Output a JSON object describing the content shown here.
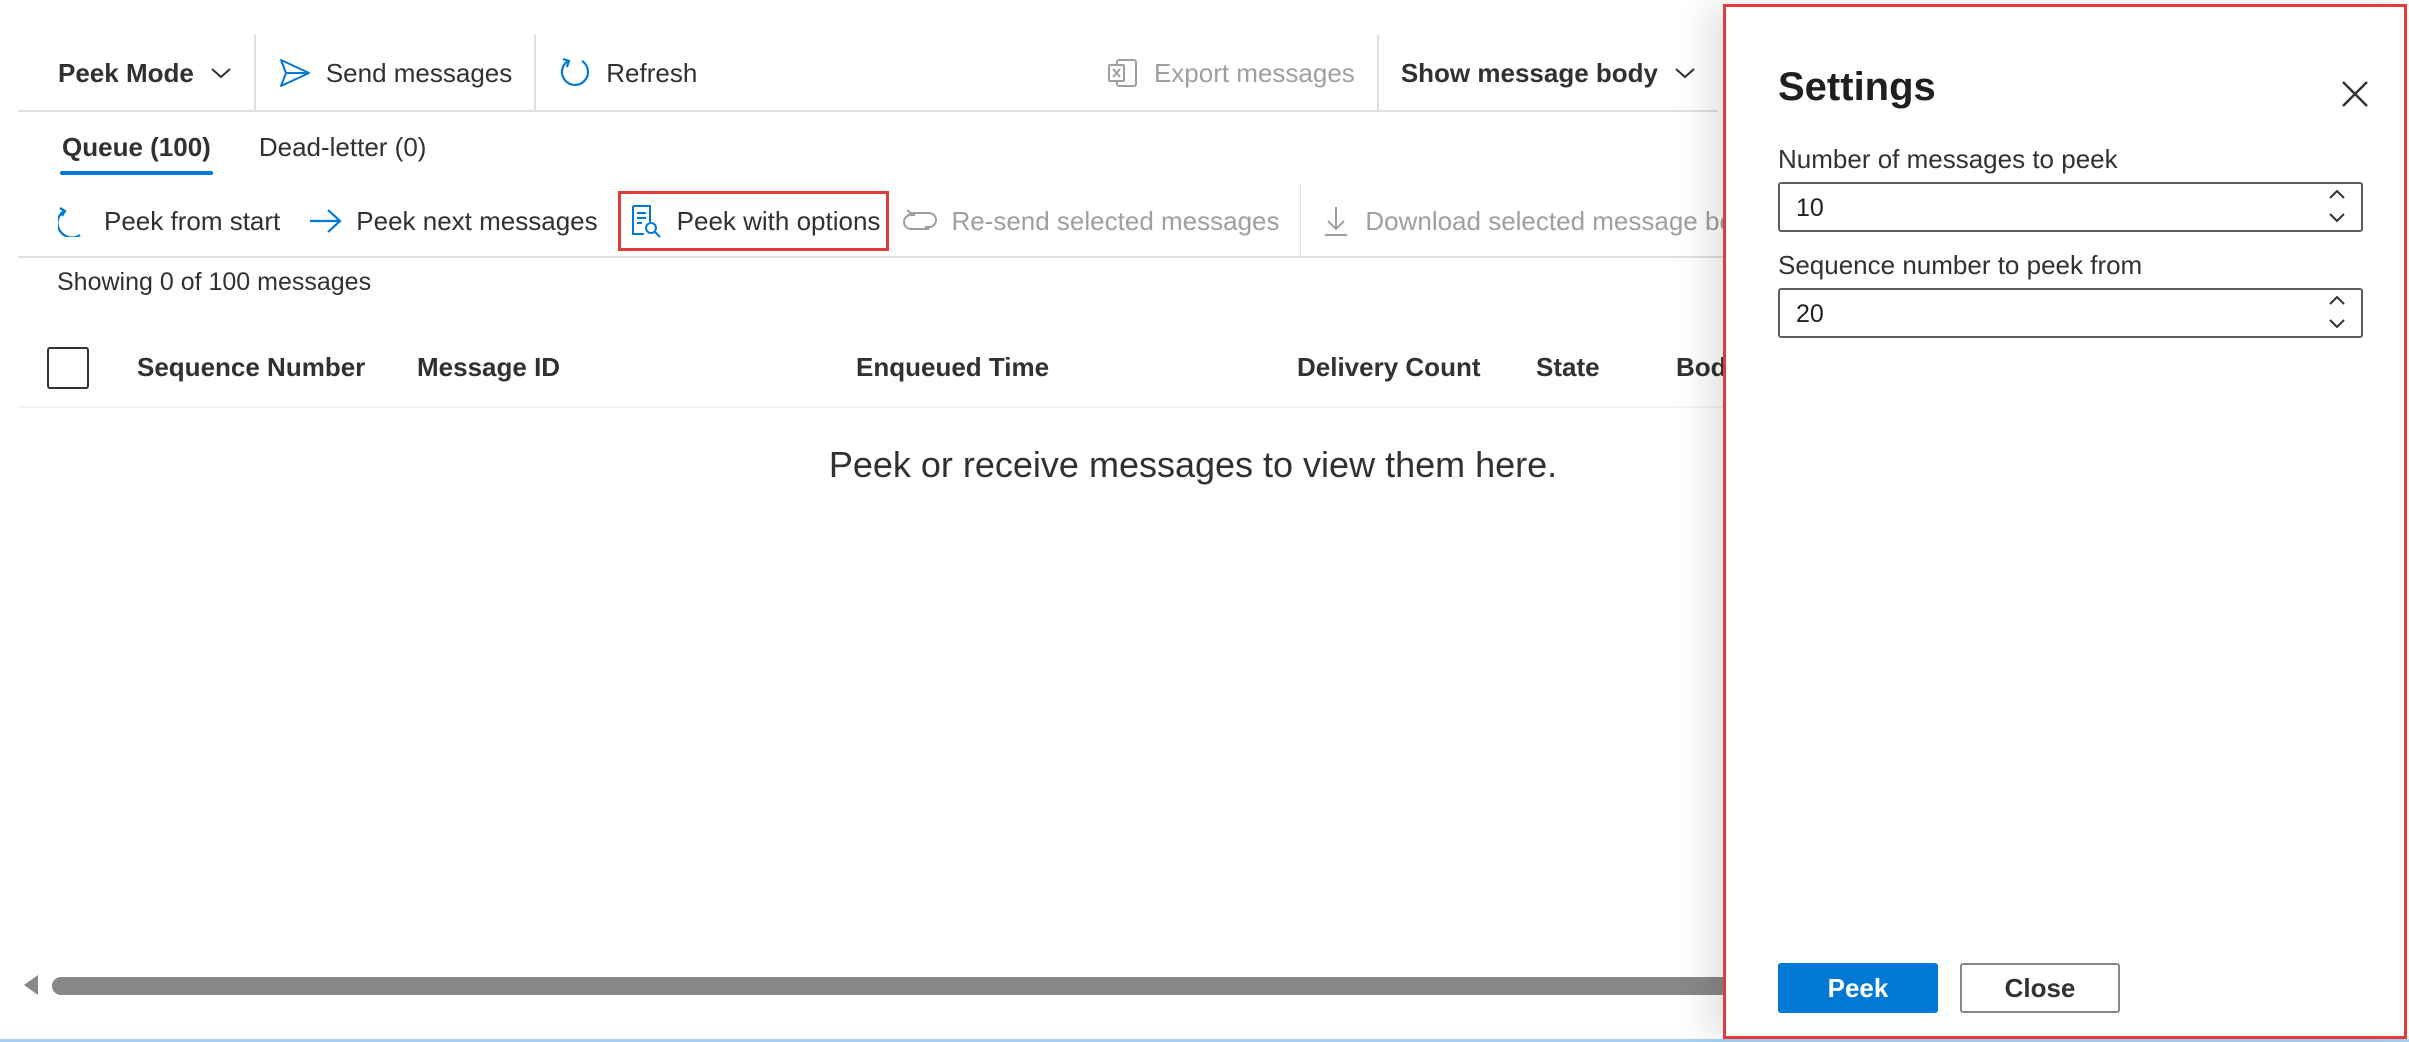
{
  "colors": {
    "accent": "#0078d4",
    "highlight": "#e03c3c",
    "disabled": "#a19f9d",
    "text": "#323130"
  },
  "commandbar": {
    "peek_mode_label": "Peek Mode",
    "send_messages_label": "Send messages",
    "refresh_label": "Refresh",
    "export_messages_label": "Export messages",
    "show_body_label": "Show message body"
  },
  "tabs": [
    {
      "label": "Queue (100)",
      "active": true
    },
    {
      "label": "Dead-letter (0)",
      "active": false
    }
  ],
  "toolbar": {
    "peek_from_start": "Peek from start",
    "peek_next": "Peek next messages",
    "peek_with_options": "Peek with options",
    "resend_selected": "Re-send selected messages",
    "download_selected": "Download selected message body"
  },
  "grid": {
    "showing_text": "Showing 0 of 100 messages",
    "columns": [
      "Sequence Number",
      "Message ID",
      "Enqueued Time",
      "Delivery Count",
      "State",
      "Body"
    ],
    "empty_text": "Peek or receive messages to view them here."
  },
  "settings": {
    "title": "Settings",
    "count_label": "Number of messages to peek",
    "count_value": "10",
    "sequence_label": "Sequence number to peek from",
    "sequence_value": "20",
    "peek_button": "Peek",
    "close_button": "Close"
  }
}
